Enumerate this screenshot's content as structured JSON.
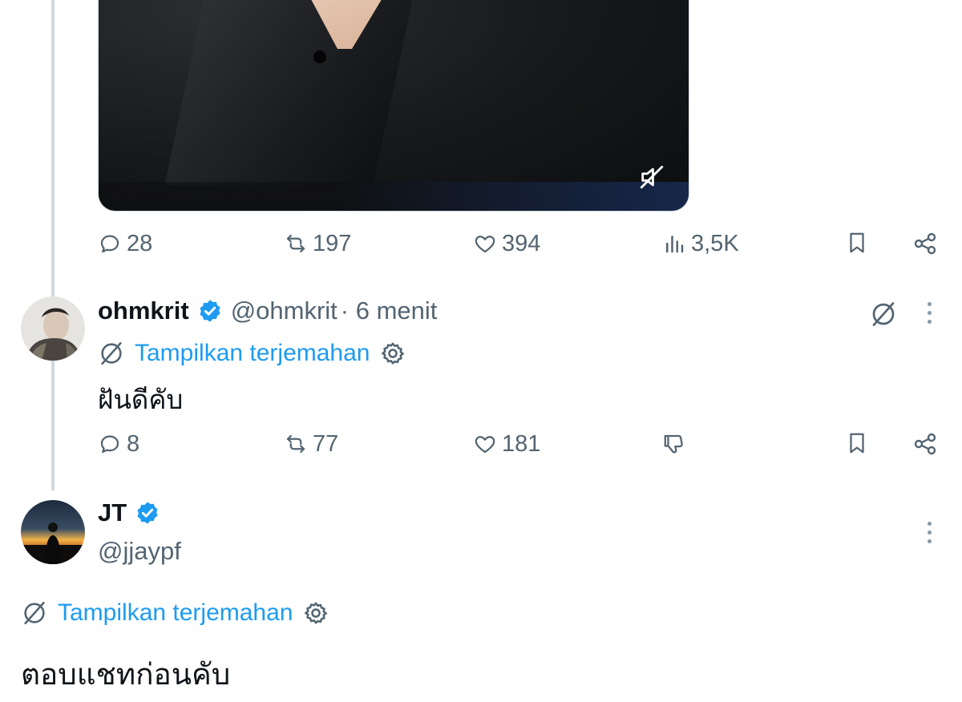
{
  "tweet_main": {
    "stats": {
      "replies": "28",
      "reposts": "197",
      "likes": "394",
      "views": "3,5K"
    }
  },
  "reply1": {
    "name": "ohmkrit",
    "handle": "@ohmkrit",
    "time": "· 6 menit",
    "translate_label": "Tampilkan terjemahan",
    "text": "ฝันดีคับ",
    "stats": {
      "replies": "8",
      "reposts": "77",
      "likes": "181"
    }
  },
  "reply2": {
    "name": "JT",
    "handle": "@jjaypf",
    "translate_label": "Tampilkan terjemahan",
    "text": "ตอบแชทก่อนคับ"
  },
  "icons": {
    "reply": "reply-icon",
    "repost": "repost-icon",
    "like": "heart-icon",
    "views": "views-icon",
    "bookmark": "bookmark-icon",
    "share": "share-icon",
    "translate": "translate-icon",
    "settings": "gear-icon",
    "verified": "verified-badge-icon",
    "mute": "muted-speaker-icon",
    "downvote": "downvote-icon",
    "more": "more-icon"
  },
  "colors": {
    "accent": "#1d9bf0",
    "secondary_text": "#536471",
    "primary_text": "#0f1419"
  }
}
